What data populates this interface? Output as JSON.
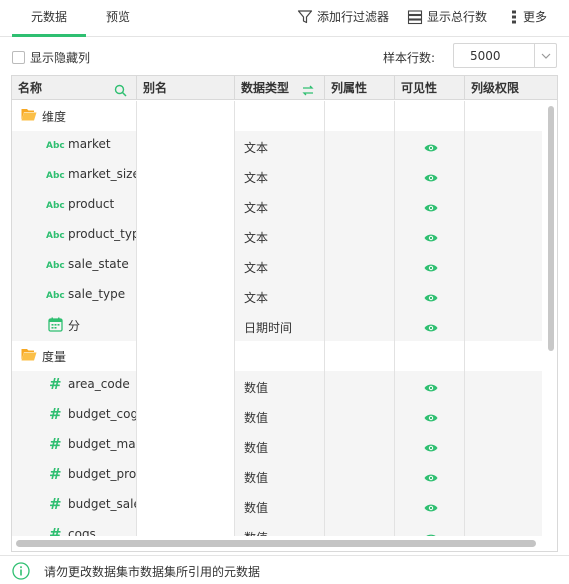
{
  "tabs": [
    {
      "label": "元数据",
      "active": true
    },
    {
      "label": "预览",
      "active": false
    }
  ],
  "toolbar": {
    "add_filter": "添加行过滤器",
    "show_total": "显示总行数",
    "more": "更多"
  },
  "options": {
    "show_hidden_label": "显示隐藏列",
    "show_hidden_checked": false,
    "sample_label": "样本行数:",
    "sample_value": "5000"
  },
  "columns": [
    "名称",
    "别名",
    "数据类型",
    "列属性",
    "可见性",
    "列级权限"
  ],
  "rows": [
    {
      "kind": "group",
      "icon": "folder-icon",
      "name": "维度",
      "type": ""
    },
    {
      "kind": "field",
      "icon": "abc-icon",
      "name": "market",
      "type": "文本",
      "visible": true
    },
    {
      "kind": "field",
      "icon": "abc-icon",
      "name": "market_size",
      "type": "文本",
      "visible": true
    },
    {
      "kind": "field",
      "icon": "abc-icon",
      "name": "product",
      "type": "文本",
      "visible": true
    },
    {
      "kind": "field",
      "icon": "abc-icon",
      "name": "product_type",
      "type": "文本",
      "visible": true
    },
    {
      "kind": "field",
      "icon": "abc-icon",
      "name": "sale_state",
      "type": "文本",
      "visible": true
    },
    {
      "kind": "field",
      "icon": "abc-icon",
      "name": "sale_type",
      "type": "文本",
      "visible": true
    },
    {
      "kind": "field",
      "icon": "calendar-icon",
      "name": "分",
      "type": "日期时间",
      "visible": true
    },
    {
      "kind": "group",
      "icon": "folder-icon",
      "name": "度量",
      "type": ""
    },
    {
      "kind": "field",
      "icon": "hash-icon",
      "name": "area_code",
      "type": "数值",
      "visible": true
    },
    {
      "kind": "field",
      "icon": "hash-icon",
      "name": "budget_cogs",
      "type": "数值",
      "visible": true
    },
    {
      "kind": "field",
      "icon": "hash-icon",
      "name": "budget_marg",
      "type": "数值",
      "visible": true
    },
    {
      "kind": "field",
      "icon": "hash-icon",
      "name": "budget_profit",
      "type": "数值",
      "visible": true
    },
    {
      "kind": "field",
      "icon": "hash-icon",
      "name": "budget_sales",
      "type": "数值",
      "visible": true
    },
    {
      "kind": "field",
      "icon": "hash-icon",
      "name": "cogs",
      "type": "数值",
      "visible": true
    }
  ],
  "footer": {
    "message": "请勿更改数据集市数据集所引用的元数据"
  },
  "colors": {
    "accent": "#2fbf71",
    "folder": "#f7a823"
  }
}
